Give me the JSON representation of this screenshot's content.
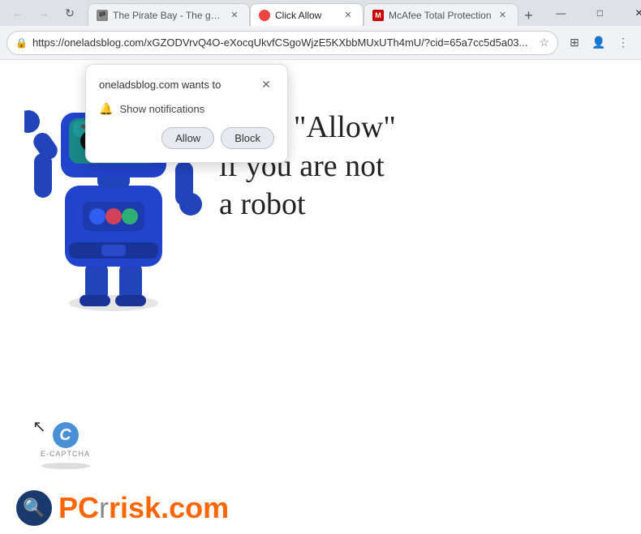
{
  "titlebar": {
    "back_btn": "←",
    "forward_btn": "→",
    "refresh_btn": "↻"
  },
  "tabs": [
    {
      "id": "tab-piratebay",
      "title": "The Pirate Bay - The galaxy's m...",
      "favicon_color": "#888",
      "active": false
    },
    {
      "id": "tab-clickallow",
      "title": "Click Allow",
      "favicon_color": "#e44",
      "active": true
    },
    {
      "id": "tab-mcafee",
      "title": "McAfee Total Protection",
      "favicon_color": "#c00",
      "active": false
    }
  ],
  "addressbar": {
    "url": "https://oneladsblog.com/xGZODVrvQ4O-eXocqUkvfCSgoWjzE5KXbbMUxUTh4mU/?cid=65a7cc5d5a03...",
    "lock_icon": "🔒"
  },
  "win_controls": {
    "minimize": "—",
    "maximize": "□",
    "close": "✕"
  },
  "notification_popup": {
    "title": "oneladsblog.com wants to",
    "close_btn": "✕",
    "notification_label": "Show notifications",
    "allow_btn": "Allow",
    "block_btn": "Block"
  },
  "page": {
    "main_text_line1": "Click \"Allow\"",
    "main_text_line2": "if you are not",
    "main_text_line3": "a robot",
    "ecaptcha_label": "E-CAPTCHA"
  },
  "pcrisk": {
    "text_gray": "PC",
    "text_orange": "risk.com"
  }
}
